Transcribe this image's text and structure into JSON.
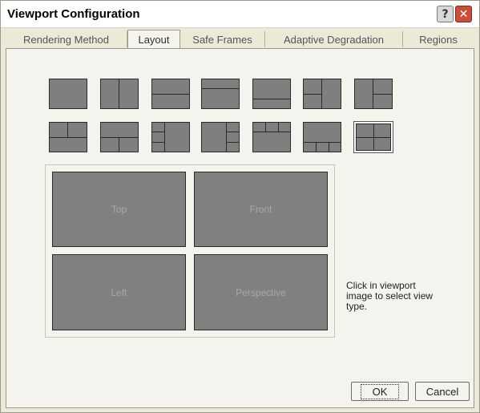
{
  "window": {
    "title": "Viewport Configuration",
    "help_glyph": "?",
    "close_glyph": "✕"
  },
  "tabs": [
    {
      "label": "Rendering Method",
      "active": false
    },
    {
      "label": "Layout",
      "active": true
    },
    {
      "label": "Safe Frames",
      "active": false
    },
    {
      "label": "Adaptive Degradation",
      "active": false
    },
    {
      "label": "Regions",
      "active": false
    }
  ],
  "layouts": {
    "count": 14,
    "selected_index": 13
  },
  "viewports": [
    {
      "label": "Top"
    },
    {
      "label": "Front"
    },
    {
      "label": "Left"
    },
    {
      "label": "Perspective"
    }
  ],
  "hint": "Click in viewport image to select view type.",
  "buttons": {
    "ok": "OK",
    "cancel": "Cancel"
  },
  "colors": {
    "dialog_bg": "#ece9d8",
    "viewport_gray": "#808080",
    "close_red": "#c94f3d"
  },
  "icons": [
    "help-icon",
    "close-icon"
  ]
}
